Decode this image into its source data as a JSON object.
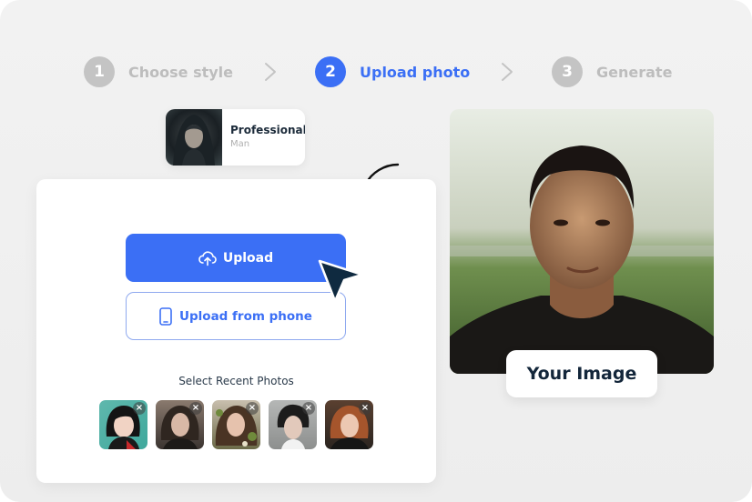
{
  "stepper": {
    "steps": [
      {
        "number": "1",
        "label": "Choose style",
        "state": "inactive"
      },
      {
        "number": "2",
        "label": "Upload photo",
        "state": "active"
      },
      {
        "number": "3",
        "label": "Generate",
        "state": "inactive"
      }
    ]
  },
  "selected_style": {
    "title": "Professional",
    "subtitle": "Man"
  },
  "upload_panel": {
    "upload_label": "Upload",
    "upload_phone_label": "Upload from phone",
    "recent_label": "Select Recent Photos",
    "recent_photos": [
      {
        "name": "recent-photo-1",
        "remove": "×"
      },
      {
        "name": "recent-photo-2",
        "remove": "×"
      },
      {
        "name": "recent-photo-3",
        "remove": "×"
      },
      {
        "name": "recent-photo-4",
        "remove": "×"
      },
      {
        "name": "recent-photo-5",
        "remove": "×"
      }
    ]
  },
  "preview": {
    "badge_label": "Your Image"
  },
  "colors": {
    "accent": "#3b6ff5",
    "inactive_step": "#c4c4c4",
    "dark_text": "#13263a"
  }
}
